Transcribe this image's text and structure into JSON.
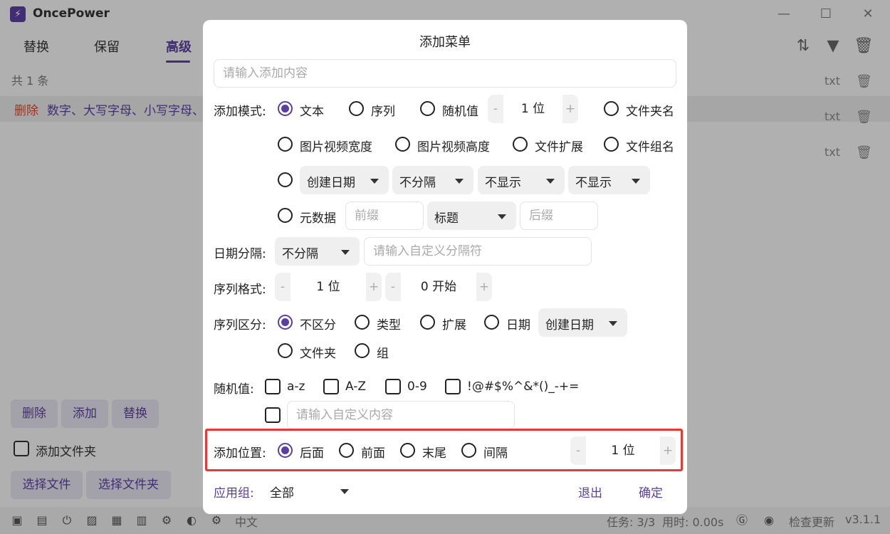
{
  "app": {
    "name": "OncePower",
    "logo_icon": "lightning-icon",
    "tabs": [
      "替换",
      "保留",
      "高级"
    ],
    "count_text": "共 1 条",
    "rule": {
      "action": "删除",
      "text": "数字、大写字母、小写字母、"
    },
    "files": [
      {
        "type": "txt"
      },
      {
        "type": "txt"
      },
      {
        "type": "txt"
      }
    ],
    "bottom_buttons": {
      "delete": "删除",
      "add": "添加",
      "replace": "替换"
    },
    "add_folder_label": "添加文件夹",
    "select_file": "选择文件",
    "select_folder": "选择文件夹",
    "status": {
      "language": "中文",
      "tasks": "任务: 3/3",
      "time": "用时: 0.00s",
      "check_update": "检查更新",
      "version": "v3.1.1"
    }
  },
  "dialog": {
    "title": "添加菜单",
    "content_placeholder": "请输入添加内容",
    "mode": {
      "label": "添加模式:",
      "text": "文本",
      "sequence": "序列",
      "random": "随机值",
      "random_digits": "1 位",
      "folder_name": "文件夹名",
      "img_width": "图片视频宽度",
      "img_height": "图片视频高度",
      "file_ext": "文件扩展",
      "file_group": "文件组名",
      "date_type": "创建日期",
      "date_sep": "不分隔",
      "show1": "不显示",
      "show2": "不显示",
      "metadata": "元数据",
      "prefix_placeholder": "前缀",
      "meta_field": "标题",
      "suffix_placeholder": "后缀"
    },
    "date_sep": {
      "label": "日期分隔:",
      "value": "不分隔",
      "placeholder": "请输入自定义分隔符"
    },
    "seq_format": {
      "label": "序列格式:",
      "digits": "1 位",
      "start": "0 开始"
    },
    "seq_distinct": {
      "label": "序列区分:",
      "none": "不区分",
      "type": "类型",
      "ext": "扩展",
      "date": "日期",
      "date_select": "创建日期",
      "folder": "文件夹",
      "group": "组"
    },
    "random": {
      "label": "随机值:",
      "lower": "a-z",
      "upper": "A-Z",
      "digits": "0-9",
      "symbols": "!@#$%^&*()_-+=",
      "custom_placeholder": "请输入自定义内容"
    },
    "position": {
      "label": "添加位置:",
      "after": "后面",
      "before": "前面",
      "end": "末尾",
      "interval": "间隔",
      "digits": "1 位"
    },
    "apply_group": {
      "label": "应用组:",
      "value": "全部"
    },
    "exit": "退出",
    "confirm": "确定"
  },
  "colors": {
    "accent": "#5a3fa0",
    "danger": "#d9472b",
    "highlight": "#e53935"
  }
}
